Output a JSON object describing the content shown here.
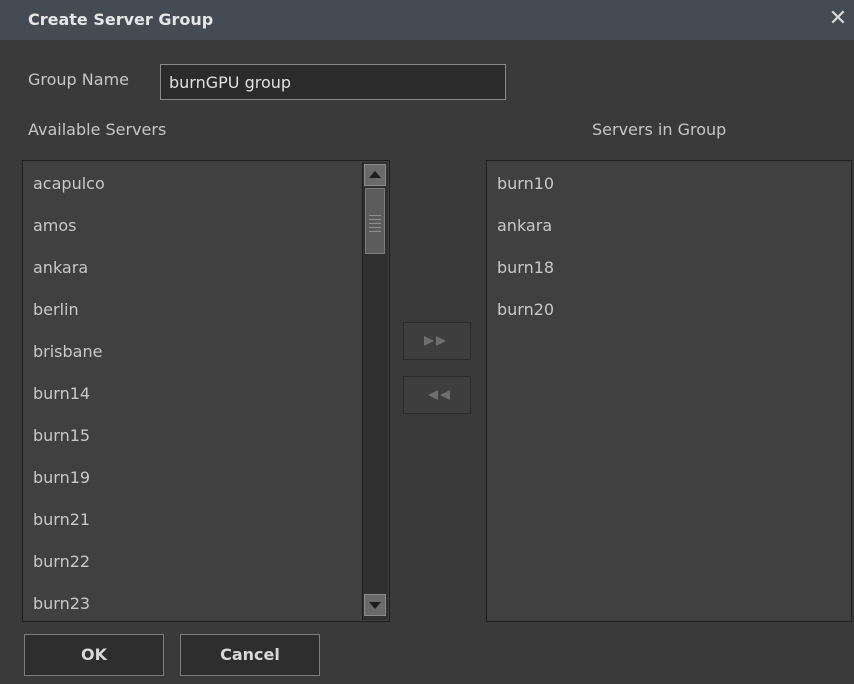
{
  "window": {
    "title": "Create Server Group",
    "close_glyph": "✕"
  },
  "group_name": {
    "label": "Group Name",
    "value": "burnGPU group"
  },
  "available": {
    "label": "Available Servers",
    "items": [
      "acapulco",
      "amos",
      "ankara",
      "berlin",
      "brisbane",
      "burn14",
      "burn15",
      "burn19",
      "burn21",
      "burn22",
      "burn23"
    ]
  },
  "in_group": {
    "label": "Servers in Group",
    "items": [
      "burn10",
      "ankara",
      "burn18",
      "burn20"
    ]
  },
  "buttons": {
    "ok": "OK",
    "cancel": "Cancel"
  },
  "icons": {
    "close": "close-icon",
    "scroll_up": "arrow-up-icon",
    "scroll_down": "arrow-down-icon",
    "add": "double-arrow-right-icon",
    "remove": "double-arrow-left-icon"
  }
}
